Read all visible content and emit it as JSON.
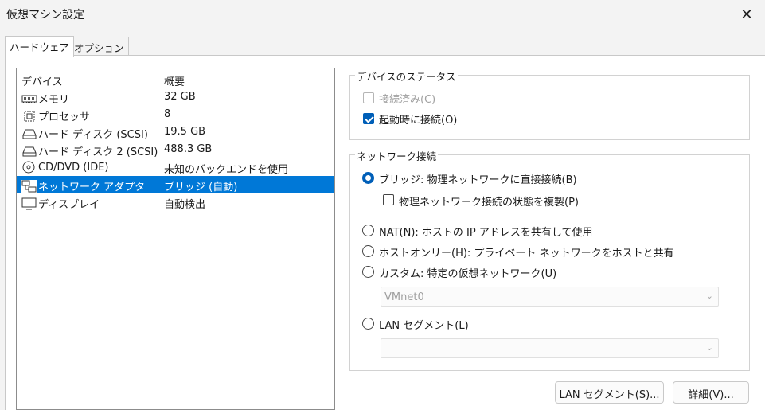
{
  "window": {
    "title": "仮想マシン設定",
    "close_glyph": "✕"
  },
  "tabs": [
    {
      "label": "ハードウェア",
      "active": true
    },
    {
      "label": "オプション",
      "active": false
    }
  ],
  "device_list": {
    "headers": {
      "device": "デバイス",
      "summary": "概要"
    },
    "rows": [
      {
        "icon": "memory-icon",
        "device": "メモリ",
        "summary": "32 GB"
      },
      {
        "icon": "processor-icon",
        "device": "プロセッサ",
        "summary": "8"
      },
      {
        "icon": "hard-disk-icon",
        "device": "ハード ディスク (SCSI)",
        "summary": "19.5 GB"
      },
      {
        "icon": "hard-disk-icon",
        "device": "ハード ディスク 2 (SCSI)",
        "summary": "488.3 GB"
      },
      {
        "icon": "cd-dvd-icon",
        "device": "CD/DVD (IDE)",
        "summary": "未知のバックエンドを使用"
      },
      {
        "icon": "network-adapter-icon",
        "device": "ネットワーク アダプタ",
        "summary": "ブリッジ (自動)",
        "selected": true
      },
      {
        "icon": "display-icon",
        "device": "ディスプレイ",
        "summary": "自動検出"
      }
    ]
  },
  "device_status": {
    "legend": "デバイスのステータス",
    "connected": {
      "label": "接続済み(C)",
      "checked": false,
      "disabled": true
    },
    "connect_at_power_on": {
      "label": "起動時に接続(O)",
      "checked": true,
      "disabled": false
    }
  },
  "network_connection": {
    "legend": "ネットワーク接続",
    "bridged": {
      "label": "ブリッジ: 物理ネットワークに直接接続(B)",
      "selected": true
    },
    "replicate": {
      "label": "物理ネットワーク接続の状態を複製(P)",
      "checked": false
    },
    "nat": {
      "label": "NAT(N): ホストの IP アドレスを共有して使用",
      "selected": false
    },
    "host_only": {
      "label": "ホストオンリー(H): プライベート ネットワークをホストと共有",
      "selected": false
    },
    "custom": {
      "label": "カスタム: 特定の仮想ネットワーク(U)",
      "selected": false
    },
    "custom_select": {
      "value": "VMnet0"
    },
    "lan_segment": {
      "label": "LAN セグメント(L)",
      "selected": false
    },
    "lan_select": {
      "value": ""
    }
  },
  "buttons": {
    "lan_segments": "LAN セグメント(S)...",
    "advanced": "詳細(V)..."
  },
  "colors": {
    "accent": "#0078d7",
    "radio_accent": "#005fb8",
    "disabled_text": "#a0a0a0"
  }
}
